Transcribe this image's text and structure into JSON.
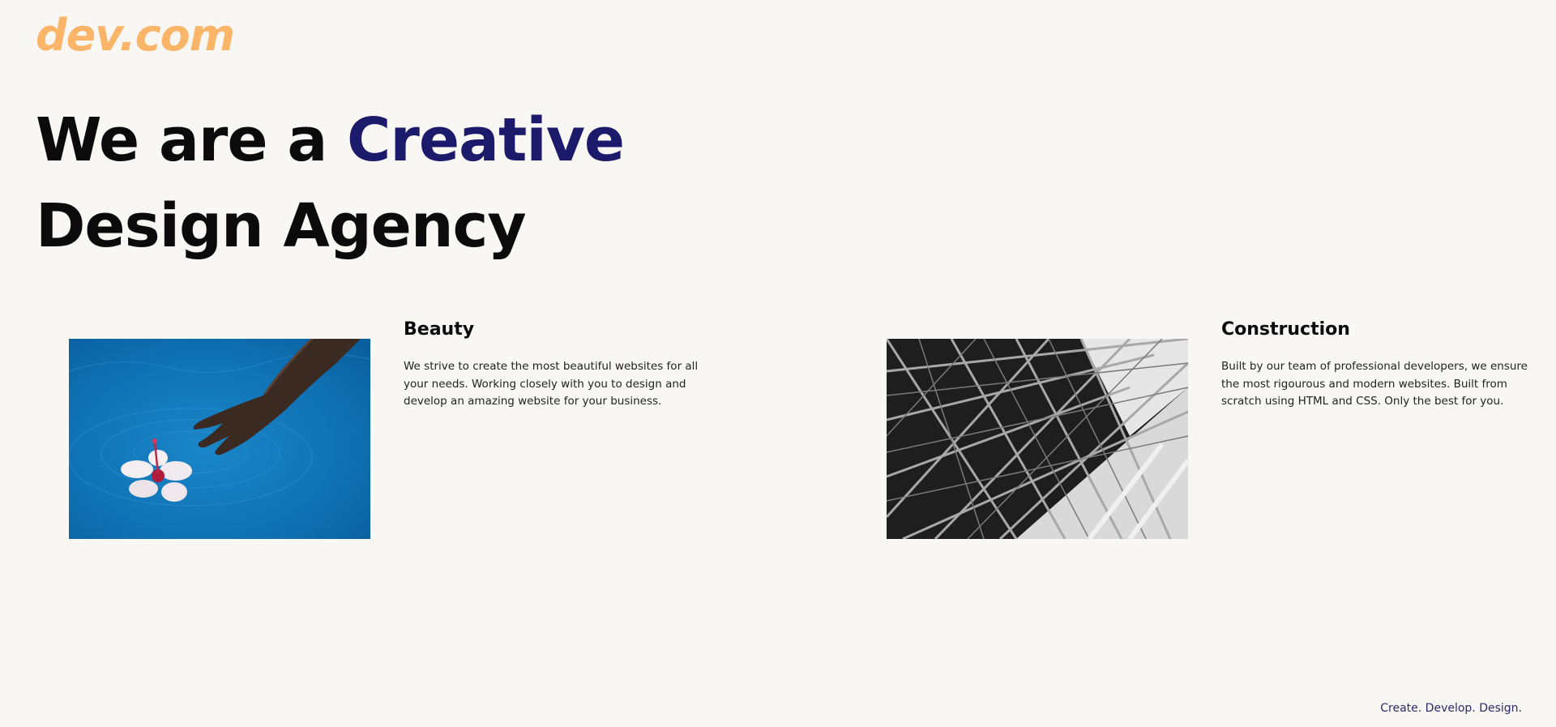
{
  "brand": {
    "logo": "dev.com"
  },
  "hero": {
    "line1_prefix": "We are a ",
    "line1_accent": "Creative",
    "line2": "Design Agency"
  },
  "cards": [
    {
      "title": "Beauty",
      "text": "We strive to create the most beautiful websites for all your needs. Working closely with you to design and develop an amazing website for your business.",
      "image": "hand-touching-flower-in-water"
    },
    {
      "title": "Construction",
      "text": "Built by our team of professional developers, we ensure the most rigourous and modern websites. Built from scratch using HTML and CSS. Only the best for you.",
      "image": "steel-scaffolding-structure"
    }
  ],
  "footer": {
    "tagline": "Create. Develop. Design."
  },
  "colors": {
    "logo": "#fbb568",
    "accent": "#1c1a6a",
    "background": "#f9f7f4"
  }
}
